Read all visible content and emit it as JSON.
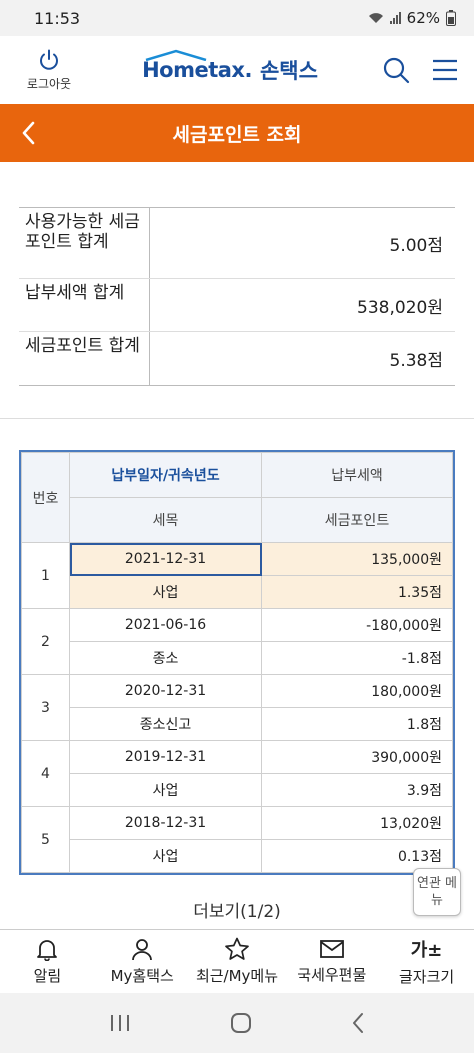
{
  "status_bar": {
    "time": "11:53",
    "battery": "62%"
  },
  "header": {
    "logout_label": "로그아웃",
    "logo_en": "Hometax.",
    "logo_kr": "손택스"
  },
  "titlebar": {
    "title": "세금포인트 조회"
  },
  "summary": [
    {
      "label": "사용가능한 세금포인트 합계",
      "value": "5.00점"
    },
    {
      "label": "납부세액 합계",
      "value": "538,020원"
    },
    {
      "label": "세금포인트 합계",
      "value": "5.38점"
    }
  ],
  "detail": {
    "headers": {
      "no": "번호",
      "date": "납부일자/귀속년도",
      "tax_amount": "납부세액",
      "tax_item": "세목",
      "point": "세금포인트"
    },
    "rows": [
      {
        "no": "1",
        "date": "2021-12-31",
        "amount": "135,000원",
        "item": "사업",
        "point": "1.35점"
      },
      {
        "no": "2",
        "date": "2021-06-16",
        "amount": "-180,000원",
        "item": "종소",
        "point": "-1.8점"
      },
      {
        "no": "3",
        "date": "2020-12-31",
        "amount": "180,000원",
        "item": "종소신고",
        "point": "1.8점"
      },
      {
        "no": "4",
        "date": "2019-12-31",
        "amount": "390,000원",
        "item": "사업",
        "point": "3.9점"
      },
      {
        "no": "5",
        "date": "2018-12-31",
        "amount": "13,020원",
        "item": "사업",
        "point": "0.13점"
      }
    ]
  },
  "more_label": "더보기(1/2)",
  "related_menu": "연관 메뉴",
  "bottom_nav": [
    {
      "label": "알림",
      "icon": "bell-icon"
    },
    {
      "label": "My홈택스",
      "icon": "person-icon"
    },
    {
      "label": "최근/My메뉴",
      "icon": "star-icon"
    },
    {
      "label": "국세우편물",
      "icon": "mail-icon"
    },
    {
      "label": "글자크기",
      "icon": "font-size-icon",
      "glyph": "가±"
    }
  ],
  "colors": {
    "accent": "#e8650d",
    "brand": "#1a4f9c",
    "table_border": "#4a7bbf",
    "selected_row": "#fcefdc"
  }
}
